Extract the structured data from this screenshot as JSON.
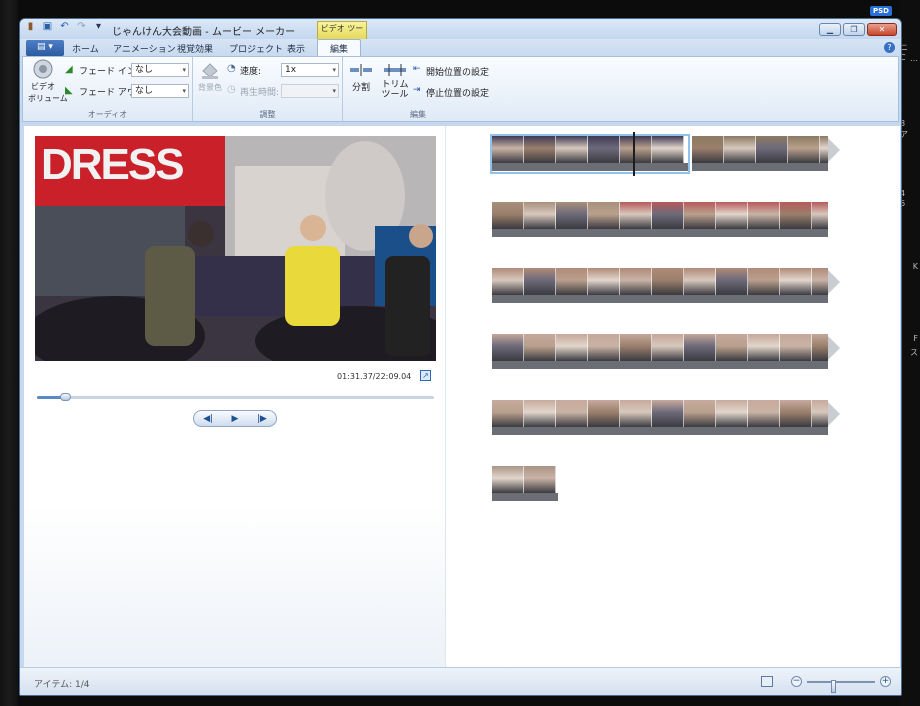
{
  "window": {
    "title": "じゃんけん大会動画 - ムービー メーカー",
    "context_tab_label": "ビデオ ツール"
  },
  "desktop": {
    "badge": "PSD",
    "edge_texts": [
      "ニ　C",
      "…",
      "8　ア",
      "4　6",
      "K",
      "F",
      "ス"
    ]
  },
  "tabs": [
    {
      "label": "ホーム"
    },
    {
      "label": "アニメーション"
    },
    {
      "label": "視覚効果"
    },
    {
      "label": "プロジェクト"
    },
    {
      "label": "表示"
    },
    {
      "label": "編集"
    }
  ],
  "ribbon": {
    "audio": {
      "group_label": "オーディオ",
      "video_volume_label_1": "ビデオ",
      "video_volume_label_2": "ボリューム",
      "fade_in_label": "フェード イン:",
      "fade_in_value": "なし",
      "fade_out_label": "フェード アウト:",
      "fade_out_value": "なし"
    },
    "adjust": {
      "group_label": "調整",
      "background_color_label": "背景色",
      "speed_label": "速度:",
      "speed_value": "1x",
      "duration_label": "再生時間:",
      "duration_value": ""
    },
    "edit": {
      "group_label": "編集",
      "split_label": "分割",
      "trim_label_1": "トリム",
      "trim_label_2": "ツール",
      "set_start_label": "開始位置の設定",
      "set_end_label": "停止位置の設定"
    }
  },
  "preview": {
    "timecode": "01:31.37/22:09.04",
    "progress": 0.07,
    "video_sign_text": "DRESS"
  },
  "status": {
    "items_text": "アイテム: 1/4"
  },
  "icons": [
    "movie-maker-icon",
    "save-icon",
    "undo-icon",
    "redo-icon",
    "qat-dropdown-icon",
    "minimize-icon",
    "restore-icon",
    "close-icon",
    "help-icon",
    "speaker-icon",
    "fade-in-icon",
    "fade-out-icon",
    "paint-bucket-icon",
    "speed-icon",
    "duration-icon",
    "split-icon",
    "trim-icon",
    "set-start-icon",
    "set-end-icon",
    "fullscreen-icon",
    "prev-frame-icon",
    "play-icon",
    "next-frame-icon",
    "storyboard-view-icon",
    "zoom-out-icon",
    "zoom-in-icon"
  ],
  "colors": {
    "accent": "#2c5aa0",
    "context_tab": "#f2e97a",
    "selection": "#8fc3ea"
  }
}
